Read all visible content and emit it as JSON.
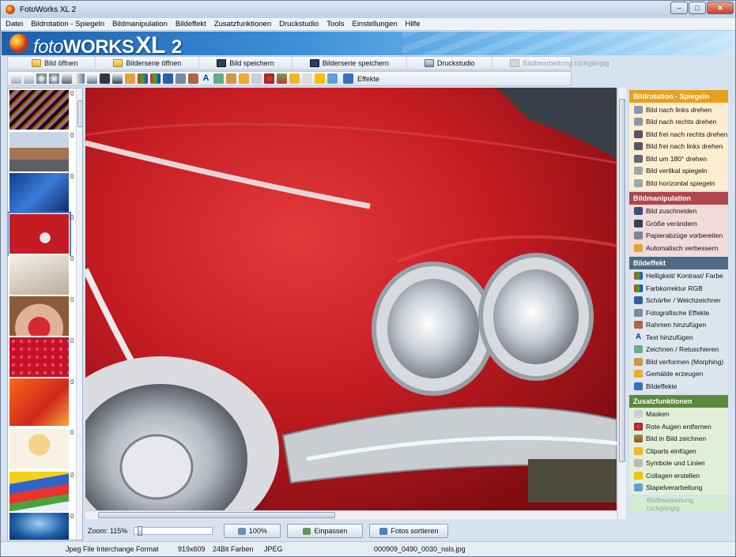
{
  "window": {
    "title": "FotoWorks XL 2",
    "controls": {
      "minimize": "–",
      "maximize": "□",
      "close": "✕"
    }
  },
  "menu": [
    "Datei",
    "Bildrotation - Spiegeln",
    "Bildmanipulation",
    "Bildeffekt",
    "Zusatzfunktionen",
    "Druckstudio",
    "Tools",
    "Einstellungen",
    "Hilfe"
  ],
  "banner": {
    "logo_prefix": "foto",
    "logo_bold": "WORKS",
    "logo_xl": "XL",
    "logo_version": "2"
  },
  "toolbar1": [
    {
      "label": "Bild öffnen",
      "icon": "folder-icon",
      "enabled": true
    },
    {
      "label": "Bilderserie öffnen",
      "icon": "folder-icon",
      "enabled": true
    },
    {
      "label": "Bild speichern",
      "icon": "save-icon",
      "enabled": true
    },
    {
      "label": "Bilderserie speichern",
      "icon": "save-icon",
      "enabled": true
    },
    {
      "label": "Druckstudio",
      "icon": "printer-icon",
      "enabled": true
    },
    {
      "label": "Bildbearbeitung rückgängig",
      "icon": "undo-icon",
      "enabled": false
    }
  ],
  "toolbar2": {
    "effects_label": "Effekte"
  },
  "thumbnails": {
    "count_label": "0"
  },
  "bottom": {
    "zoom_label": "Zoom: 115%",
    "btn_100": "100%",
    "btn_fit": "Einpassen",
    "btn_sort": "Fotos sortieren"
  },
  "status": {
    "format": "Jpeg File Interchange Format",
    "dimensions": "919x609",
    "colors": "24Bit Farben",
    "type": "JPEG",
    "filename": "000909_0490_0030_nsls.jpg"
  },
  "panel": {
    "sections": [
      {
        "title": "Bildrotation - Spiegeln",
        "head_color": "#e8a11a",
        "bg_color": "#fdeecf",
        "items": [
          "Bild nach links drehen",
          "Bild nach rechts drehen",
          "Bild frei nach rechts drehen",
          "Bild frei nach links drehen",
          "Bild um 180° drehen",
          "Bild vertikal spiegeln",
          "Bild horizontal spiegeln"
        ]
      },
      {
        "title": "Bildmanipulation",
        "head_color": "#b0474d",
        "bg_color": "#f1dada",
        "items": [
          "Bild zuschneiden",
          "Größe verändern",
          "Papierabzüge vorbereiten",
          "Automatisch verbessern"
        ]
      },
      {
        "title": "Bildeffekt",
        "head_color": "#4e6a85",
        "bg_color": "#dde6ef",
        "items": [
          "Helligkeit/ Kontrast/ Farbe",
          "Farbkorrektur RGB",
          "Schärfer / Weichzeichner",
          "Fotografische Effekte",
          "Rahmen hinzufügen",
          "Text hinzufügen",
          "Zeichnen / Retuschieren",
          "Bild verformen (Morphing)",
          "Gemälde erzeugen",
          "Bildeffekte"
        ]
      },
      {
        "title": "Zusatzfunktionen",
        "head_color": "#5a8a3c",
        "bg_color": "#e2efd8",
        "items": [
          "Masken",
          "Rote Augen entfernen",
          "Bild in Bild zeichnen",
          "Cliparts einfügen",
          "Symbole und Linien",
          "Collagen erstellen",
          "Stapelverarbeitung"
        ]
      }
    ],
    "disabled_item": "Bildbearbeitung rückgängig"
  }
}
